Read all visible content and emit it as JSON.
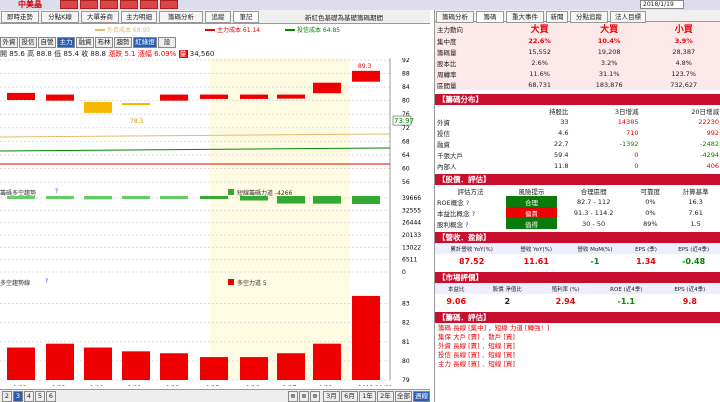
{
  "topbar": {
    "stock_name": "中美晶",
    "red_buttons": [
      "",
      "",
      "",
      "",
      "",
      ""
    ],
    "date_value": "2018/1/19"
  },
  "left_tabs": [
    "即時走勢",
    "分點K線",
    "大單券商",
    "主力明細",
    "籌碼分析",
    "追蹤",
    "筆記"
  ],
  "left_title": "技術分析 籌碼 分析/明細",
  "left_caption": "新紅色基礎為基礎籌碼期間",
  "legend": {
    "foreign": "外資成本 68.93",
    "main": "主力成本 61.14",
    "trust": "投信成本 64.85"
  },
  "toolbar2": [
    "外資",
    "投信",
    "自營",
    "主力",
    "融資",
    "布林",
    "趨勢",
    "紅綠燈",
    "設"
  ],
  "ohlc": {
    "open_l": "開",
    "open": "85.6",
    "high_l": "高",
    "high": "88.8",
    "low_l": "低",
    "low": "85.4",
    "close_l": "收",
    "close": "88.8",
    "chg": "漲跌 5.1",
    "pct": "漲幅 6.09%",
    "vol_icon": "量",
    "vol": "34,560"
  },
  "price_axis": [
    "92",
    "88",
    "84",
    "80",
    "76",
    "72",
    "68",
    "64",
    "60",
    "56"
  ],
  "price_tag": "73.97",
  "low_tag": "78.3",
  "high_tag": "89.3",
  "panel2": {
    "title": "籌碼多空趨勢",
    "q": "?",
    "legend": "短線籌碼力道 -4266",
    "axis": [
      "39666",
      "32555",
      "26444",
      "20133",
      "13022",
      "6511",
      "0"
    ]
  },
  "panel3": {
    "title": "多空趨勢線",
    "q": "?",
    "legend": "多空力道 5",
    "axis": [
      "83",
      "82",
      "81",
      "80",
      "79"
    ]
  },
  "chart_data": [
    {
      "type": "bar",
      "title": "",
      "categories": [
        "1/08",
        "1/09",
        "1/10",
        "1/11",
        "1/12",
        "1/15",
        "1/16",
        "1/17",
        "1/18",
        "1/19"
      ],
      "ylim": [
        56,
        92
      ],
      "series": [
        {
          "name": "",
          "values": [
            {
              "open": 80.2,
              "close": 82.3
            },
            {
              "open": 80.0,
              "close": 81.8
            },
            {
              "open": 76.4,
              "close": 79.6
            },
            {
              "open": 78.8,
              "close": 79.3
            },
            {
              "open": 80.0,
              "close": 81.8
            },
            {
              "open": 80.5,
              "close": 81.8
            },
            {
              "open": 80.5,
              "close": 81.8
            },
            {
              "open": 80.6,
              "close": 81.8
            },
            {
              "open": 82.2,
              "close": 85.3
            },
            {
              "open": 85.6,
              "close": 88.8
            }
          ]
        }
      ]
    },
    {
      "type": "bar",
      "title": "",
      "categories": [
        "1/08",
        "1/09",
        "1/10",
        "1/11",
        "1/12",
        "1/15",
        "1/16",
        "1/17",
        "1/18",
        "1/19"
      ],
      "ylim": [
        0,
        39666
      ],
      "series": [
        {
          "name": "短線籌碼力道",
          "values": [
            -1200,
            -1500,
            -1800,
            -1300,
            -1500,
            -1500,
            -2400,
            -4000,
            -4100,
            -4266
          ]
        }
      ]
    },
    {
      "type": "bar",
      "title": "",
      "categories": [
        "1/08",
        "1/09",
        "1/10",
        "1/11",
        "1/12",
        "1/15",
        "1/16",
        "1/17",
        "1/18",
        "1/19"
      ],
      "ylim": [
        79,
        83.5
      ],
      "series": [
        {
          "name": "多空力道",
          "values": [
            80.7,
            80.9,
            80.7,
            80.5,
            80.4,
            80.2,
            80.2,
            80.4,
            80.9,
            83.4
          ]
        }
      ]
    }
  ],
  "xaxis": {
    "labels": [
      "1/08",
      "1/09",
      "1/10",
      "1/11",
      "1/12",
      "1/15",
      "1/16",
      "1/17",
      "1/18",
      "2018/01/19"
    ],
    "year": "2018"
  },
  "bottom_buttons": [
    "3月",
    "6月",
    "1年",
    "2年",
    "全部",
    "週線"
  ],
  "pages": [
    "2",
    "3",
    "4",
    "5",
    "6"
  ],
  "right": {
    "tabs": [
      "籌碼分析",
      "籌碼",
      "重大事件",
      "新聞",
      "分點追蹤",
      "法人目標"
    ],
    "trend": {
      "label": "主力動向",
      "cols": [
        "大買",
        "大買",
        "小買"
      ],
      "rows": [
        {
          "l": "集中度",
          "v": [
            "22.6%",
            "10.4%",
            "3.9%"
          ]
        },
        {
          "l": "籌碼量",
          "v": [
            "15,552",
            "19,208",
            "28,387"
          ]
        },
        {
          "l": "股本比",
          "v": [
            "2.6%",
            "3.2%",
            "4.8%"
          ]
        },
        {
          "l": "周轉率",
          "v": [
            "11.6%",
            "31.1%",
            "123.7%"
          ]
        },
        {
          "l": "區間量",
          "v": [
            "68,731",
            "183,876",
            "732,627"
          ]
        }
      ]
    },
    "dist": {
      "title": "【籌碼分布】",
      "cols": [
        "持股比",
        "3日增減",
        "20日增減"
      ],
      "rows": [
        {
          "l": "外資",
          "v": [
            "33",
            "14385",
            "22230"
          ]
        },
        {
          "l": "投信",
          "v": [
            "4.6",
            "710",
            "992"
          ]
        },
        {
          "l": "融資",
          "v": [
            "22.7",
            "-1392",
            "-2482"
          ]
        },
        {
          "l": "千張大戶",
          "v": [
            "59.4",
            "0",
            "-4294"
          ]
        },
        {
          "l": "內部人",
          "v": [
            "11.8",
            "0",
            "406"
          ]
        }
      ]
    },
    "value": {
      "title": "【股價．評估】",
      "cols": [
        "評估方法",
        "風險提示",
        "合理區間",
        "可靠度",
        "計算基準"
      ],
      "rows": [
        {
          "l": "ROE概念",
          "q": "?",
          "b": "合理",
          "r": "82.7 - 112",
          "p": "0%",
          "c": "16.3"
        },
        {
          "l": "本益比概念",
          "q": "?",
          "b": "偏貴",
          "r": "91.3 - 114.2",
          "p": "0%",
          "c": "7.61"
        },
        {
          "l": "股利概念",
          "q": "?",
          "b": "值得",
          "r": "30 - 50",
          "p": "89%",
          "c": "1.5"
        }
      ]
    },
    "revenue": {
      "title": "【營收．盈餘】",
      "cols": [
        "累計營收 YoY(%)",
        "營收 YoY(%)",
        "營收 MoM(%)",
        "EPS (季)",
        "EPS (近4季)"
      ],
      "vals": [
        "87.52",
        "11.61",
        "-1",
        "1.34",
        "-0.48"
      ]
    },
    "market": {
      "title": "【市場評價】",
      "cols": [
        "本益比",
        "股價 淨值比",
        "殖利率 (%)",
        "ROE (近4季)",
        "EPS (近4季)"
      ],
      "vals": [
        "9.06",
        "2",
        "2.94",
        "-1.1",
        "9.8"
      ]
    },
    "chip_eval": {
      "title": "【籌碼．評估】",
      "lines": [
        "籌碼 長線 [集中] ，短線 力道 [轉強！]",
        "集保 大戶 [賣] ．散戶 [買]",
        "外資 長線 [賣] ．短線 [買]",
        "投信 長線 [買] ．短線 [買]",
        "主力 長線 [買] ．短線 [買]"
      ]
    }
  }
}
